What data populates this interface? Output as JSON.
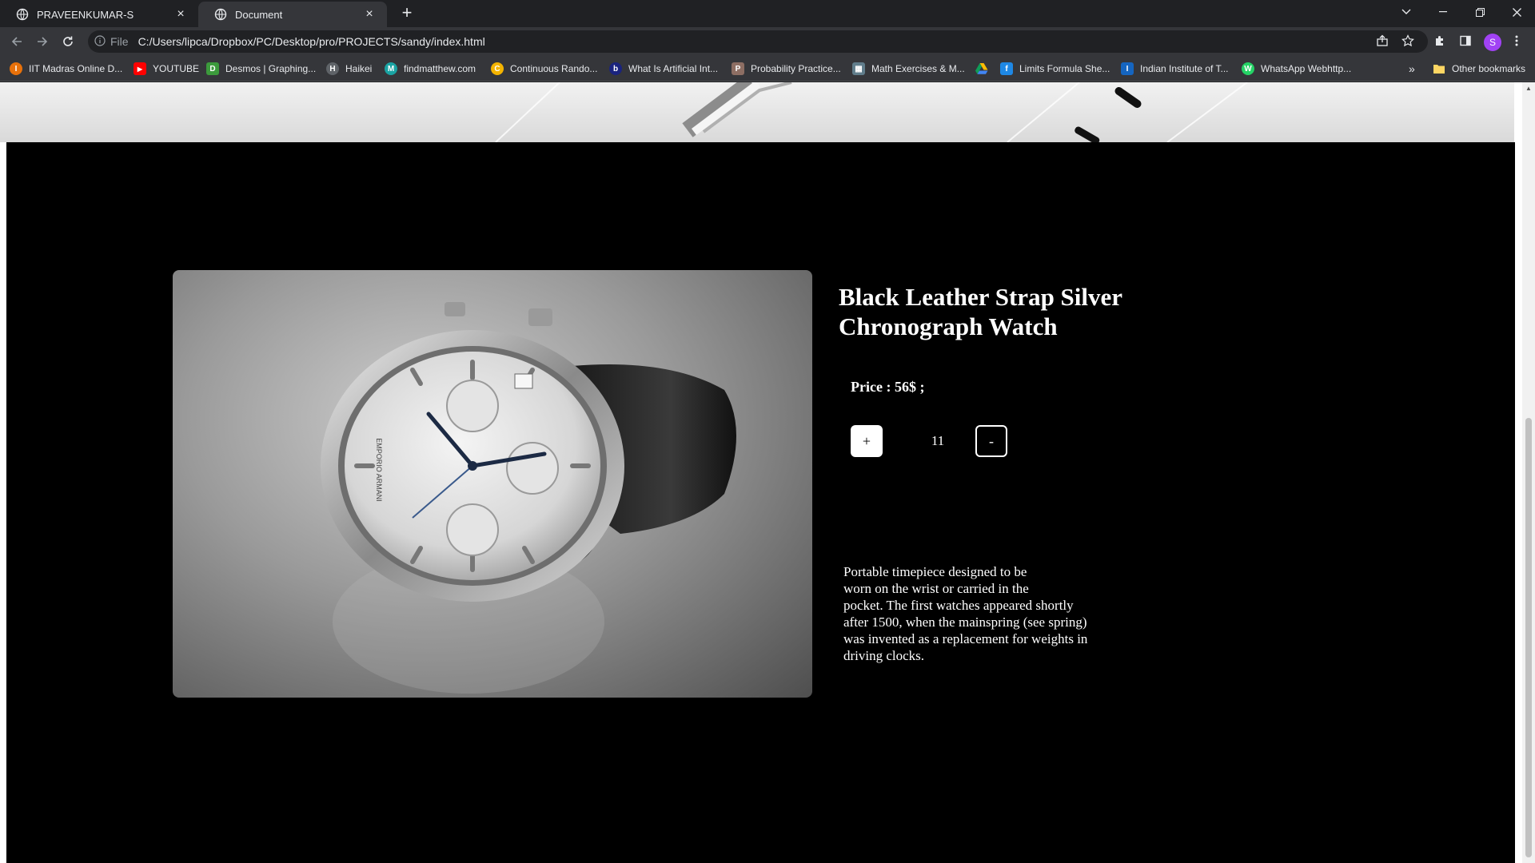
{
  "browser": {
    "tabs": [
      {
        "title": "PRAVEENKUMAR-S",
        "active": false
      },
      {
        "title": "Document",
        "active": true
      }
    ],
    "new_tab_icon": "plus-icon",
    "address": {
      "scheme": "File",
      "url": "C:/Users/lipca/Dropbox/PC/Desktop/pro/PROJECTS/sandy/index.html"
    },
    "profile_initial": "S",
    "bookmarks": [
      {
        "label": "IIT Madras Online D...",
        "color": "#e8710a",
        "glyph": "I"
      },
      {
        "label": "YOUTUBE",
        "color": "#ff0000",
        "glyph": "▶"
      },
      {
        "label": "Desmos | Graphing...",
        "color": "#3c9a3c",
        "glyph": "D"
      },
      {
        "label": "Haikei",
        "color": "#5f6368",
        "glyph": "H"
      },
      {
        "label": "findmatthew.com",
        "color": "#1aa3a3",
        "glyph": "M"
      },
      {
        "label": "Continuous Rando...",
        "color": "#f4b400",
        "glyph": "C"
      },
      {
        "label": "What Is Artificial Int...",
        "color": "#1a237e",
        "glyph": "b"
      },
      {
        "label": "Probability Practice...",
        "color": "#8d6e63",
        "glyph": "P"
      },
      {
        "label": "Math Exercises & M...",
        "color": "#607d8b",
        "glyph": "▦"
      },
      {
        "label": "Limits Formula She...",
        "color": "#1e88e5",
        "glyph": "f"
      },
      {
        "label": "Indian Institute of T...",
        "color": "#1565c0",
        "glyph": "I"
      },
      {
        "label": "WhatsApp Webhttp...",
        "color": "#25d366",
        "glyph": "W"
      }
    ],
    "overflow_label": "»",
    "other_bookmarks": "Other bookmarks"
  },
  "product": {
    "title": "Black Leather Strap Silver Chronograph Watch",
    "price_label": "Price : 56$ ;",
    "plus_label": "+",
    "quantity": "11",
    "minus_label": "-",
    "description_lines": [
      "Portable timepiece designed to be",
      "worn on the wrist or carried in the",
      "pocket. The first watches appeared shortly",
      "after 1500, when the mainspring (see spring)",
      "was invented as a replacement for weights in",
      "driving clocks."
    ],
    "watch_dial_brand": "EMPORIO ARMANI"
  },
  "colors": {
    "page_bg": "#000000",
    "text": "#ffffff",
    "chrome_dark": "#202124",
    "chrome_mid": "#35363a"
  }
}
